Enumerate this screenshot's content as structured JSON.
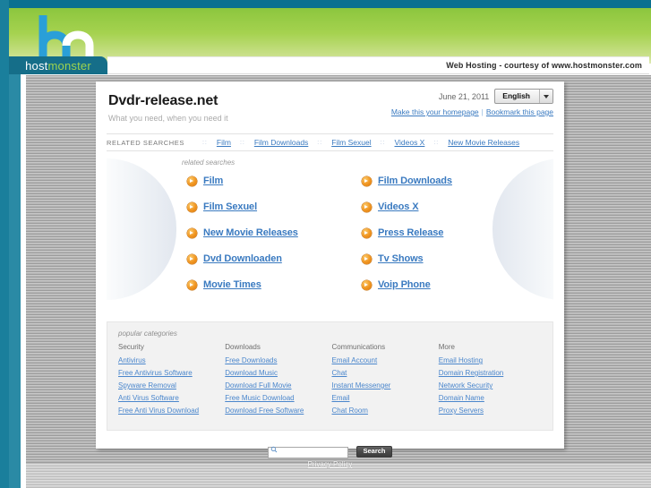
{
  "browser": {
    "top_strip_color": "#0a7090",
    "rail_color": "#1a7f9c"
  },
  "banner": {
    "logo_alt": "hostmonster-h-m-monogram",
    "tab_host": "host",
    "tab_monster": "monster",
    "courtesy_text": "Web Hosting - courtesy of www.hostmonster.com",
    "green_start": "#8cc63e",
    "green_end": "#dfe9b5"
  },
  "header": {
    "site_title": "Dvdr-release.net",
    "tagline": "What you need, when you need it",
    "date": "June 21, 2011",
    "language": "English",
    "homepage_link": "Make this your homepage",
    "separator": "|",
    "bookmark_link": "Bookmark this page"
  },
  "nav": {
    "label": "RELATED SEARCHES",
    "separator": "::",
    "items": [
      {
        "label": "Film"
      },
      {
        "label": "Film Downloads"
      },
      {
        "label": "Film Sexuel"
      },
      {
        "label": "Videos X"
      },
      {
        "label": "New Movie Releases"
      }
    ]
  },
  "results": {
    "heading": "related searches",
    "icon": "orange-arrow-icon",
    "items": [
      {
        "label": "Film"
      },
      {
        "label": "Film Downloads"
      },
      {
        "label": "Film Sexuel"
      },
      {
        "label": "Videos X"
      },
      {
        "label": "New Movie Releases"
      },
      {
        "label": "Press Release"
      },
      {
        "label": "Dvd Downloaden"
      },
      {
        "label": "Tv Shows"
      },
      {
        "label": "Movie Times"
      },
      {
        "label": "Voip Phone"
      }
    ]
  },
  "categories": {
    "heading": "popular categories",
    "columns": [
      {
        "title": "Security",
        "links": [
          "Antivirus",
          "Free Antivirus Software",
          "Spyware Removal",
          "Anti Virus Software",
          "Free Anti Virus Download"
        ]
      },
      {
        "title": "Downloads",
        "links": [
          "Free Downloads",
          "Download Music",
          "Download Full Movie",
          "Free Music Download",
          "Download Free Software"
        ]
      },
      {
        "title": "Communications",
        "links": [
          "Email Account",
          "Chat",
          "Instant Messenger",
          "Email",
          "Chat Room"
        ]
      },
      {
        "title": "More",
        "links": [
          "Email Hosting",
          "Domain Registration",
          "Network Security",
          "Domain Name",
          "Proxy Servers"
        ]
      }
    ]
  },
  "search": {
    "value": "",
    "placeholder": "",
    "button_label": "Search",
    "icon": "magnifier-icon"
  },
  "footer": {
    "privacy_label": "Privacy Policy"
  },
  "colors": {
    "link_blue": "#3a7ac0",
    "accent_orange": "#f0941f",
    "panel_bg": "#ffffff",
    "cats_bg": "#f2f2f2"
  }
}
